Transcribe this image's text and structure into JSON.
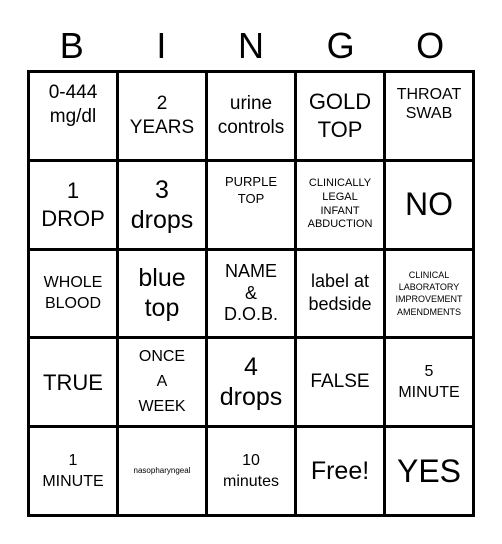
{
  "header": {
    "letters": [
      "B",
      "I",
      "N",
      "G",
      "O"
    ]
  },
  "cells": [
    "0-444\nmg/dl",
    "2\nYEARS",
    "urine\ncontrols",
    "GOLD\nTOP",
    "THROAT\nSWAB",
    "1\nDROP",
    "3\ndrops",
    "PURPLE\nTOP",
    "CLINICALLY\nLEGAL\nINFANT\nABDUCTION",
    "NO",
    "WHOLE\nBLOOD",
    "blue\ntop",
    "NAME\n&\nD.O.B.",
    "label at\nbedside",
    "CLINICAL\nLABORATORY\nIMPROVEMENT\nAMENDMENTS",
    "TRUE",
    "ONCE\nA\nWEEK",
    "4\ndrops",
    "FALSE",
    "5\nMINUTE",
    "1\nMINUTE",
    "nasopharyngeal",
    "10\nminutes",
    "Free!",
    "YES"
  ]
}
